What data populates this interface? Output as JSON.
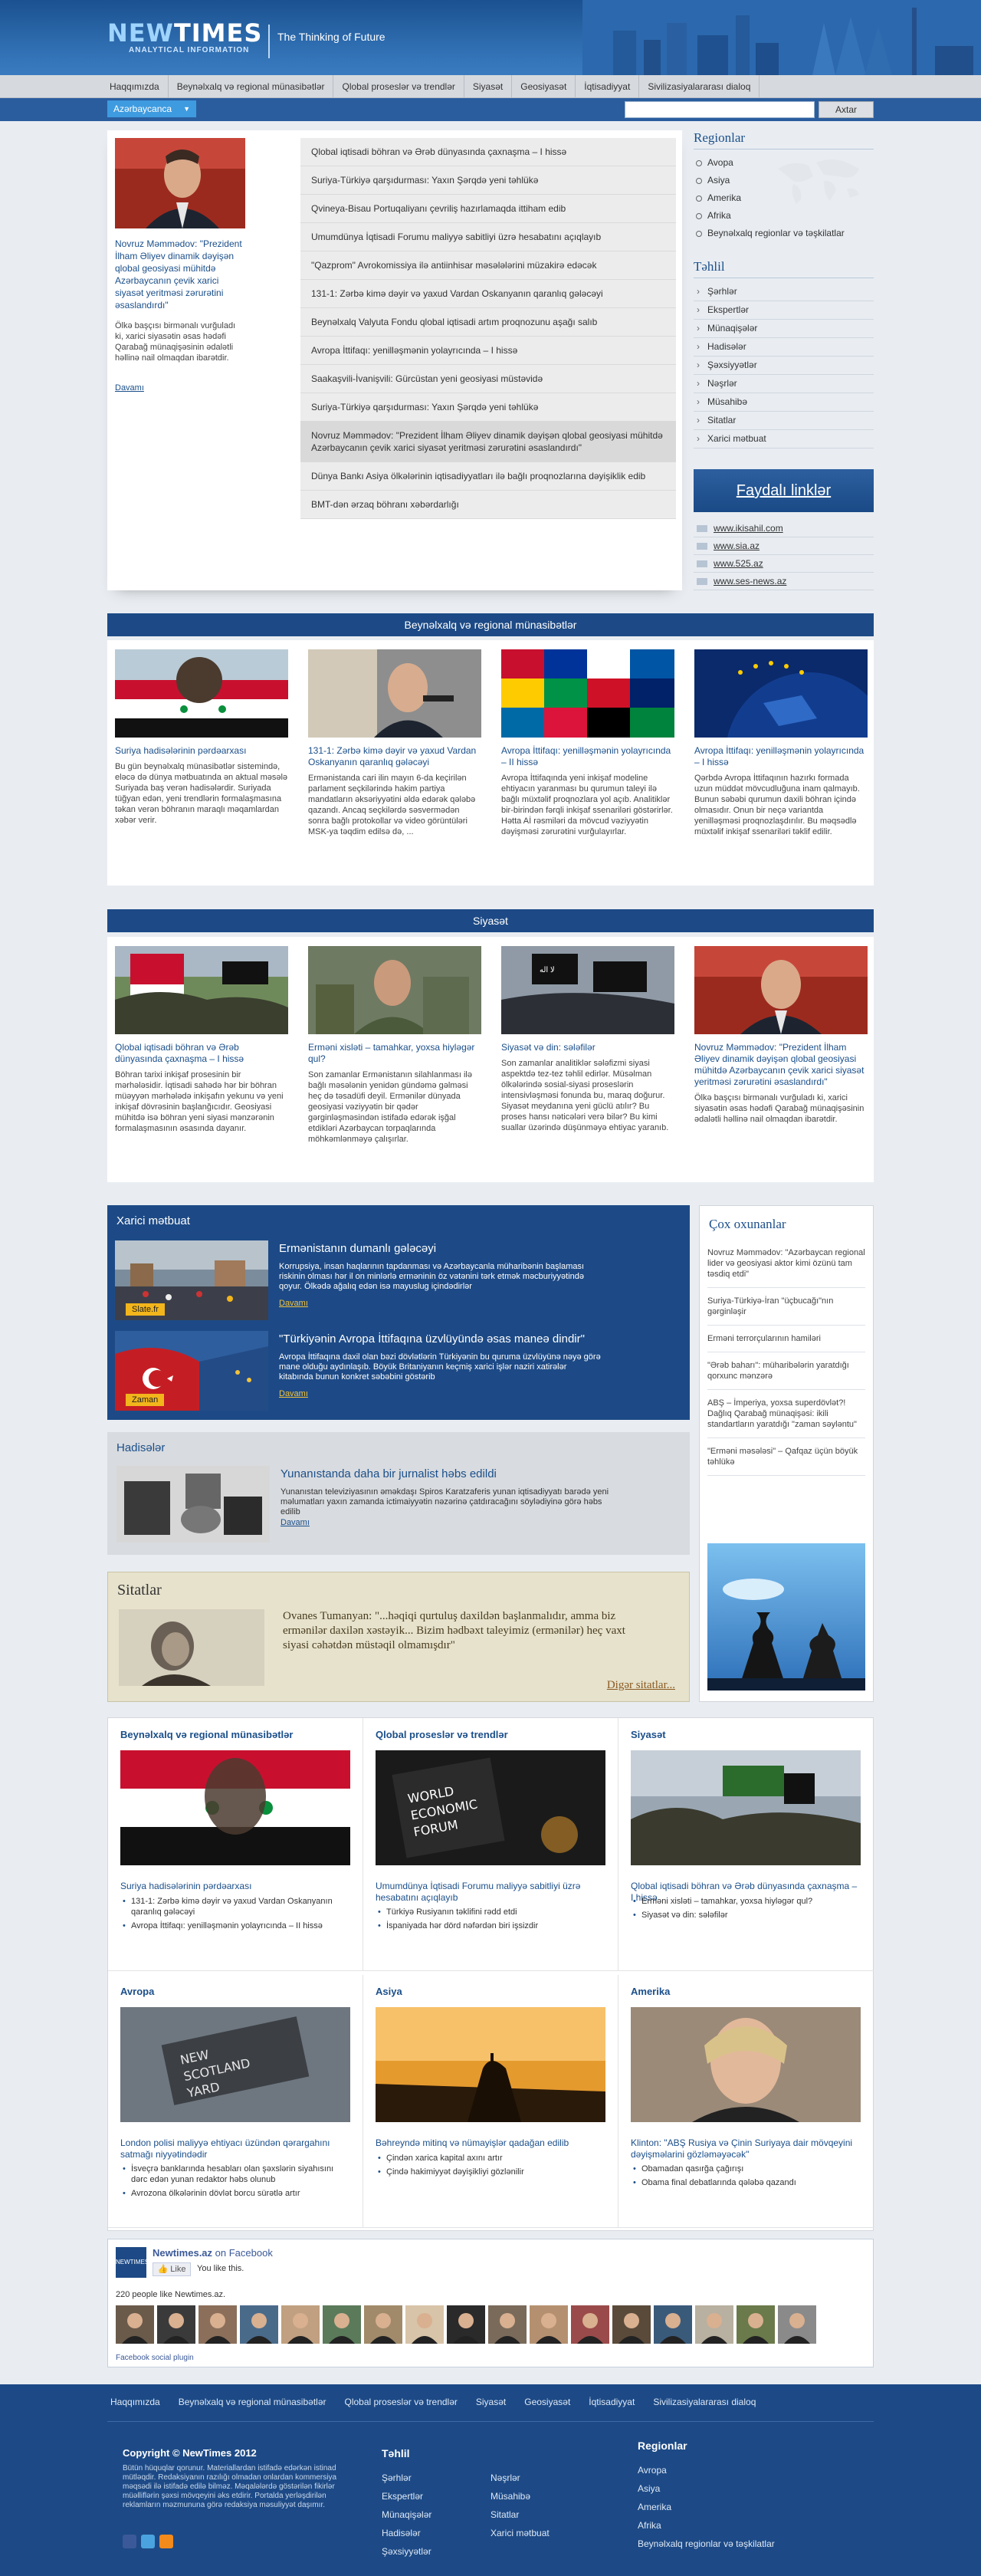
{
  "header": {
    "brand_a": "NEW",
    "brand_b": "TIMES",
    "brand_sub": "ANALYTICAL INFORMATION",
    "tagline": "The Thinking of Future"
  },
  "topnav": [
    "Haqqımızda",
    "Beynəlxalq və regional münasibətlər",
    "Qlobal proseslər və trendlər",
    "Siyasət",
    "Geosiyasət",
    "İqtisadiyyat",
    "Sivilizasiyalararası dialoq"
  ],
  "toolbar": {
    "language": "Azərbaycanca",
    "search_value": "",
    "search_button": "Axtar"
  },
  "featured": {
    "title": "Novruz Məmmədov: \"Prezident İlham Əliyev dinamik dəyişən qlobal geosiyasi mühitdə Azərbaycanın çevik xarici siyasət yeritməsi zərurətini əsaslandırdı\"",
    "text": "Ölkə başçısı birmənalı vurğuladı ki, xarici siyasətin əsas hədəfi Qarabağ münaqişəsinin ədalətli həllinə nail olmaqdan ibarətdir.",
    "more": "Davamı",
    "headlines": [
      "Qlobal iqtisadi böhran və Ərəb dünyasında çaxnaşma – I hissə",
      "Suriya-Türkiyə qarşıdurması: Yaxın Şərqdə yeni təhlükə",
      "Qvineya-Bisau Portuqaliyanı çevriliş hazırlamaqda ittiham edib",
      "Umumdünya İqtisadi Forumu maliyyə sabitliyi üzrə hesabatını açıqlayıb",
      "\"Qazprom\" Avrokomissiya ilə antiinhisar məsələlərini müzakirə edəcək",
      "131-1: Zərbə kimə dəyir və yaxud Vardan Oskanyanın qaranlıq gələcəyi",
      "Beynəlxalq Valyuta Fondu qlobal iqtisadi artım proqnozunu aşağı salıb",
      "Avropa İttifaqı: yenilləşmənin yolayrıcında – I hissə",
      "Saakaşvili-İvanişvili: Gürcüstan yeni geosiyasi müstəvidə",
      "Suriya-Türkiyə qarşıdurması: Yaxın Şərqdə yeni təhlükə",
      "Novruz Məmmədov: \"Prezident İlham Əliyev dinamik dəyişən qlobal geosiyasi mühitdə Azərbaycanın çevik xarici siyasət yeritməsi zərurətini əsaslandırdı\"",
      "Dünya Bankı Asiya ölkələrinin iqtisadiyyatları ilə bağlı proqnozlarına dəyişiklik edib",
      "BMT-dən ərzaq böhranı xəbərdarlığı"
    ]
  },
  "sidebar": {
    "regions_title": "Regionlar",
    "regions": [
      "Avopa",
      "Asiya",
      "Amerika",
      "Afrika",
      "Beynəlxalq regionlar və təşkilatlar"
    ],
    "analysis_title": "Təhlil",
    "analysis": [
      "Şərhlər",
      "Ekspertlər",
      "Münaqişələr",
      "Hadisələr",
      "Şəxsiyyətlər",
      "Nəşrlər",
      "Müsahibə",
      "Sitatlar",
      "Xarici mətbuat"
    ],
    "links_banner": "Faydalı linklər",
    "links": [
      "www.ikisahil.com",
      "www.sia.az",
      "www.525.az",
      "www.ses-news.az"
    ]
  },
  "section1": {
    "title": "Beynəlxalq və regional münasibətlər",
    "cards": [
      {
        "title": "Suriya hadisələrinin pərdəarxası",
        "text": "Bu gün beynəlxalq münasibətlər sistemində, eləcə də dünya mətbuatında ən aktual məsələ Suriyada baş verən hadisələrdir. Suriyada tüğyan edən, yeni trendlərin formalaşmasına təkan verən böhranın maraqlı məqamlardan xəbər verir."
      },
      {
        "title": "131-1: Zərbə kimə dəyir və yaxud Vardan Oskanyanın qaranlıq gələcəyi",
        "text": "Ermənistanda cari ilin mayın 6-da keçirilən parlament seçkilərində hakim partiya mandatların əksəriyyətini əldə edərək qələbə qazandı. Ancaq seçkilərdə səsvermədən sonra bağlı protokollar və video görüntüləri MSK-ya təqdim edilsə də, ..."
      },
      {
        "title": "Avropa İttifaqı: yenilləşmənin yolayrıcında – II hissə",
        "text": "Avropa İttifaqında yeni inkişaf modeline ehtiyacın yaranması bu qurumun taleyi ilə bağlı müxtəlif proqnozlara yol açıb. Analitiklər bir-birindən fərqli inkişaf ssenariləri göstərirlər. Hətta Aİ rəsmiləri da mövcud vəziyyətin dəyişməsi zərurətini vurğulayırlar."
      },
      {
        "title": "Avropa İttifaqı: yenilləşmənin yolayrıcında – I hissə",
        "text": "Qərbdə Avropa İttifaqının hazırkı formada uzun müddət mövcudluğuna inam qalmayıb. Bunun səbəbi qurumun daxili böhran içində olmasıdır. Onun bir neçə variantda yenilləşməsi proqnozlaşdırılır. Bu məqsədlə müxtəlif inkişaf ssenariləri təklif edilir."
      }
    ]
  },
  "section2": {
    "title": "Siyasət",
    "cards": [
      {
        "title": "Qlobal iqtisadi böhran və Ərəb dünyasında çaxnaşma – I hissə",
        "text": "Böhran tarixi inkişaf prosesinin bir mərhələsidir. İqtisadi sahədə hər bir böhran müəyyən mərhələdə inkişafın yekunu və yeni inkişaf dövrəsinin başlanğıcıdır. Geosiyasi mühitdə isə böhran yeni siyasi mənzərənin formalaşmasının əsasında dayanır."
      },
      {
        "title": "Erməni xisləti – tamahkar, yoxsa hiyləgər qul?",
        "text": "Son zamanlar Ermənistanın silahlanması ilə bağlı məsələnin yenidən gündəmə gəlməsi heç də təsadüfi deyil. Ermənilər dünyada geosiyasi vəziyyətin bir qədər gərginləşməsindən istifadə edərək işğal etdikləri Azərbaycan torpaqlarında möhkəmlənməyə çalışırlar."
      },
      {
        "title": "Siyasət və din: sələfilər",
        "text": "Son zamanlar analitiklər sələfizmi siyasi aspektdə tez-tez təhlil edirlər. Müsəlman ölkələrində sosial-siyasi proseslərin intensivləşməsi fonunda bu, maraq doğurur. Siyasət meydanına yeni güclü atılır? Bu proses hansı nəticələri verə bilər? Bu kimi suallar üzərində düşünməyə ehtiyac yaranıb."
      },
      {
        "title": "Novruz Məmmədov: \"Prezident İlham Əliyev dinamik dəyişən qlobal geosiyasi mühitdə Azərbaycanın çevik xarici siyasət yeritməsi zərurətini əsaslandırdı\"",
        "text": "Ölkə başçısı birmənalı vurğuladı ki, xarici siyasətin əsas hədəfi Qarabağ münaqişəsinin ədalətli həllinə nail olmaqdan ibarətdir."
      }
    ]
  },
  "foreign": {
    "title": "Xarici mətbuat",
    "items": [
      {
        "tag": "Slate.fr",
        "title": "Ermənistanın dumanlı gələcəyi",
        "text": "Korrupsiya, insan haqlarının tapdanması və Azərbaycanla müharibənin başlaması riskinin olması hər il on minlərlə erməninin öz vətənini tərk etmək məcburiyyətində qoyur. Ölkədə ağalıq edən isə mayuslug içindədirlər",
        "more": "Davamı"
      },
      {
        "tag": "Zaman",
        "title": "\"Türkiyənin Avropa İttifaqına üzvlüyündə əsas maneə dindir\"",
        "text": "Avropa İttifaqına daxil olan bəzi dövlətlərin Türkiyənin bu quruma üzvlüyünə nəyə görə mane olduğu aydınlaşıb. Böyük Britaniyanın keçmiş xarici işlər naziri xatirələr kitabında bunun konkret səbəbini göstərib",
        "more": "Davamı"
      }
    ]
  },
  "events": {
    "title": "Hadisələr",
    "item_title": "Yunanıstanda daha bir jurnalist həbs edildi",
    "item_text": "Yunanıstan televiziyasının əməkdaşı Spiros Karatzaferis yunan iqtisadiyyatı barədə yeni məlumatları yaxın zamanda ictimaiyyətin nəzərinə çatdıracağını söylədiyinə görə həbs edilib",
    "more": "Davamı"
  },
  "quotes": {
    "title": "Sitatlar",
    "text": "Ovanes Tumanyan: \"...həqiqi qurtuluş daxildən başlanmalıdır, amma biz ermənilər daxilən xəstəyik... Bizim hədbəxt taleyimiz (ermənilər) heç vaxt siyasi cəhətdən müstəqil olmamışdır\"",
    "more": "Digər sitatlar..."
  },
  "popular": {
    "title": "Çox oxunanlar",
    "items": [
      "Novruz Məmmədov: \"Azərbaycan regional lider və geosiyasi aktor kimi özünü tam təsdiq etdi\"",
      "Suriya-Türkiyə-İran \"üçbucağı\"nın gərginləşir",
      "Erməni terrorçularının hamiləri",
      "\"Ərəb baharı\": müharibələrin yaratdığı qorxunc mənzərə",
      "ABŞ – İmperiya, yoxsa superdövlət?! Dağlıq Qarabağ münaqişəsi: ikili standartların yaratdığı \"zaman səyləntu\"",
      "\"Erməni məsələsi\" – Qafqaz üçün böyük təhlükə"
    ]
  },
  "grid": [
    {
      "heading": "Beynəlxalq və regional münasibətlər",
      "title": "Suriya hadisələrinin pərdəarxası",
      "bullets": [
        "131-1: Zərbə kimə dəyir və yaxud Vardan Oskanyanın qaranlıq gələcəyi",
        "Avropa İttifaqı: yenilləşmənin yolayrıcında – II hissə"
      ]
    },
    {
      "heading": "Qlobal proseslər və trendlər",
      "title": "Umumdünya İqtisadi Forumu maliyyə sabitliyi üzrə hesabatını açıqlayıb",
      "bullets": [
        "Türkiyə Rusiyanın təklifini rədd etdi",
        "İspaniyada hər dörd nəfərdən biri işsizdir"
      ]
    },
    {
      "heading": "Siyasət",
      "title": "Qlobal iqtisadi böhran və Ərəb dünyasında çaxnaşma – I hissə",
      "bullets": [
        "Erməni xisləti – tamahkar, yoxsa hiyləgər qul?",
        "Siyasət və din: sələfilər"
      ]
    },
    {
      "heading": "Avropa",
      "title": "London polisi maliyyə ehtiyacı üzündən qərargahını satmağı niyyətindədir",
      "bullets": [
        "İsveçrə banklarında hesabları olan şəxslərin siyahısını dərc edən yunan redaktor həbs olunub",
        "Avrozona ölkələrinin dövlət borcu sürətlə artır"
      ]
    },
    {
      "heading": "Asiya",
      "title": "Bəhreyndə mitinq və nümayişlər qadağan edilib",
      "bullets": [
        "Çindən xarica kapital axını artır",
        "Çində hakimiyyət dəyişikliyi gözlənilir"
      ]
    },
    {
      "heading": "Amerika",
      "title": "Klinton: \"ABŞ Rusiya və Çinin Suriyaya dair mövqeyini dəyişməlarini gözləməyəcək\"",
      "bullets": [
        "Obamadan qasırğa çağırışı",
        "Obama final debatlarında qələbə qazandı"
      ]
    }
  ],
  "facebook": {
    "page": "Newtimes.az",
    "on": "on Facebook",
    "like": "Like",
    "likes_you": "You like this.",
    "count": "220 people like Newtimes.az.",
    "plugin": "Facebook social plugin",
    "logo": "NEWTIMES"
  },
  "footer": {
    "nav": [
      "Haqqımızda",
      "Beynəlxalq və regional münasibətlər",
      "Qlobal proseslər və trendlər",
      "Siyasət",
      "Geosiyasət",
      "İqtisadiyyat",
      "Sivilizasiyalararası dialoq"
    ],
    "copyright": "Copyright © NewTimes 2012",
    "copy_text": "Bütün hüquqlar qorunur. Materiallardan istifadə edərkən istinad mütləqdir. Redaksiyanın razılığı olmadan onlardan kommersiya məqsədi ilə istifadə edilə bilməz. Məqalələrdə göstərilən fikirlər müəlliflərin şəxsi mövqeyini əks etdirir. Portalda yerləşdirilən reklamların məzmununa görə redaksiya məsuliyyət daşımır.",
    "analysis_title": "Təhlil",
    "analysis_a": [
      "Şərhlər",
      "Ekspertlər",
      "Münaqişələr",
      "Hadisələr",
      "Şəxsiyyətlər"
    ],
    "analysis_b": [
      "Nəşrlər",
      "Müsahibə",
      "Sitatlar",
      "Xarici mətbuat"
    ],
    "regions_title": "Regionlar",
    "regions": [
      "Avropa",
      "Asiya",
      "Amerika",
      "Afrika",
      "Beynəlxalq regionlar və təşkilatlar"
    ]
  },
  "colors": {
    "brand_blue": "#1d4a86",
    "accent_light": "#3e9be0",
    "link": "#1b4f8a",
    "tag_yellow": "#f2b51b"
  }
}
